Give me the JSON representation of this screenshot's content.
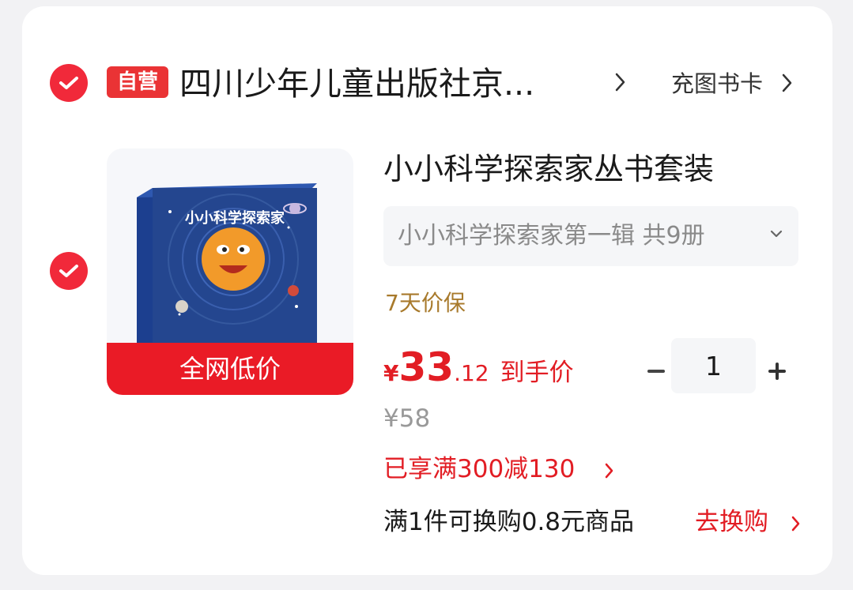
{
  "header": {
    "self_operated_badge": "自营",
    "shop_name": "四川少年儿童出版社京...",
    "coupon_link": "充图书卡"
  },
  "product": {
    "cover_title": "小小科学探索家",
    "promo_banner": "全网低价",
    "title": "小小科学探索家丛书套装",
    "variant": "小小科学探索家第一辑 共9册",
    "guarantee": "7天价保",
    "price": {
      "currency": "¥",
      "integer": "33",
      "decimal": ".12",
      "label": "到手价"
    },
    "original_price": "¥58",
    "quantity": "1",
    "promotion": "已享满300减130",
    "exchange": {
      "text": "满1件可换购0.8元商品",
      "link": "去换购"
    }
  },
  "colors": {
    "accent_red": "#e21d24",
    "guarantee_gold": "#a87a2c",
    "muted_gray": "#999999"
  }
}
